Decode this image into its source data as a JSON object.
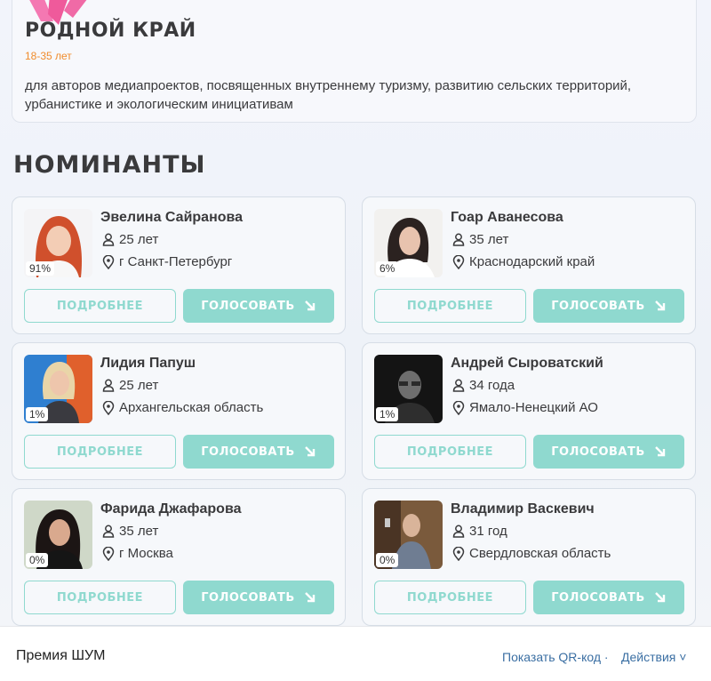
{
  "category": {
    "title": "РОДНОЙ КРАЙ",
    "age": "18-35 лет",
    "description": "для авторов медиапроектов, посвященных внутреннему туризму, развитию сельских территорий, урбанистике и экологическим инициативам"
  },
  "section_title": "НОМИНАНТЫ",
  "buttons": {
    "more": "ПОДРОБНЕЕ",
    "vote": "ГОЛОСОВАТЬ"
  },
  "nominees": [
    {
      "name": "Эвелина Сайранова",
      "age": "25 лет",
      "location": "г Санкт-Петербург",
      "percent": "91%"
    },
    {
      "name": "Гоар Аванесова",
      "age": "35 лет",
      "location": "Краснодарский край",
      "percent": "6%"
    },
    {
      "name": "Лидия Папуш",
      "age": "25 лет",
      "location": "Архангельская область",
      "percent": "1%"
    },
    {
      "name": "Андрей Сыроватский",
      "age": "34 года",
      "location": "Ямало-Ненецкий АО",
      "percent": "1%"
    },
    {
      "name": "Фарида Джафарова",
      "age": "35 лет",
      "location": "г Москва",
      "percent": "0%"
    },
    {
      "name": "Владимир Васкевич",
      "age": "31 год",
      "location": "Свердловская область",
      "percent": "0%"
    }
  ],
  "footer": {
    "title": "Премия ШУМ",
    "qr_link": "Показать QR-код ·",
    "actions": "Действия ˅"
  },
  "colors": {
    "accent_teal": "#8fd9cf",
    "age_orange": "#f08b2c",
    "link_blue": "#3b6fa3",
    "logo_pink": "#f06aa6"
  }
}
